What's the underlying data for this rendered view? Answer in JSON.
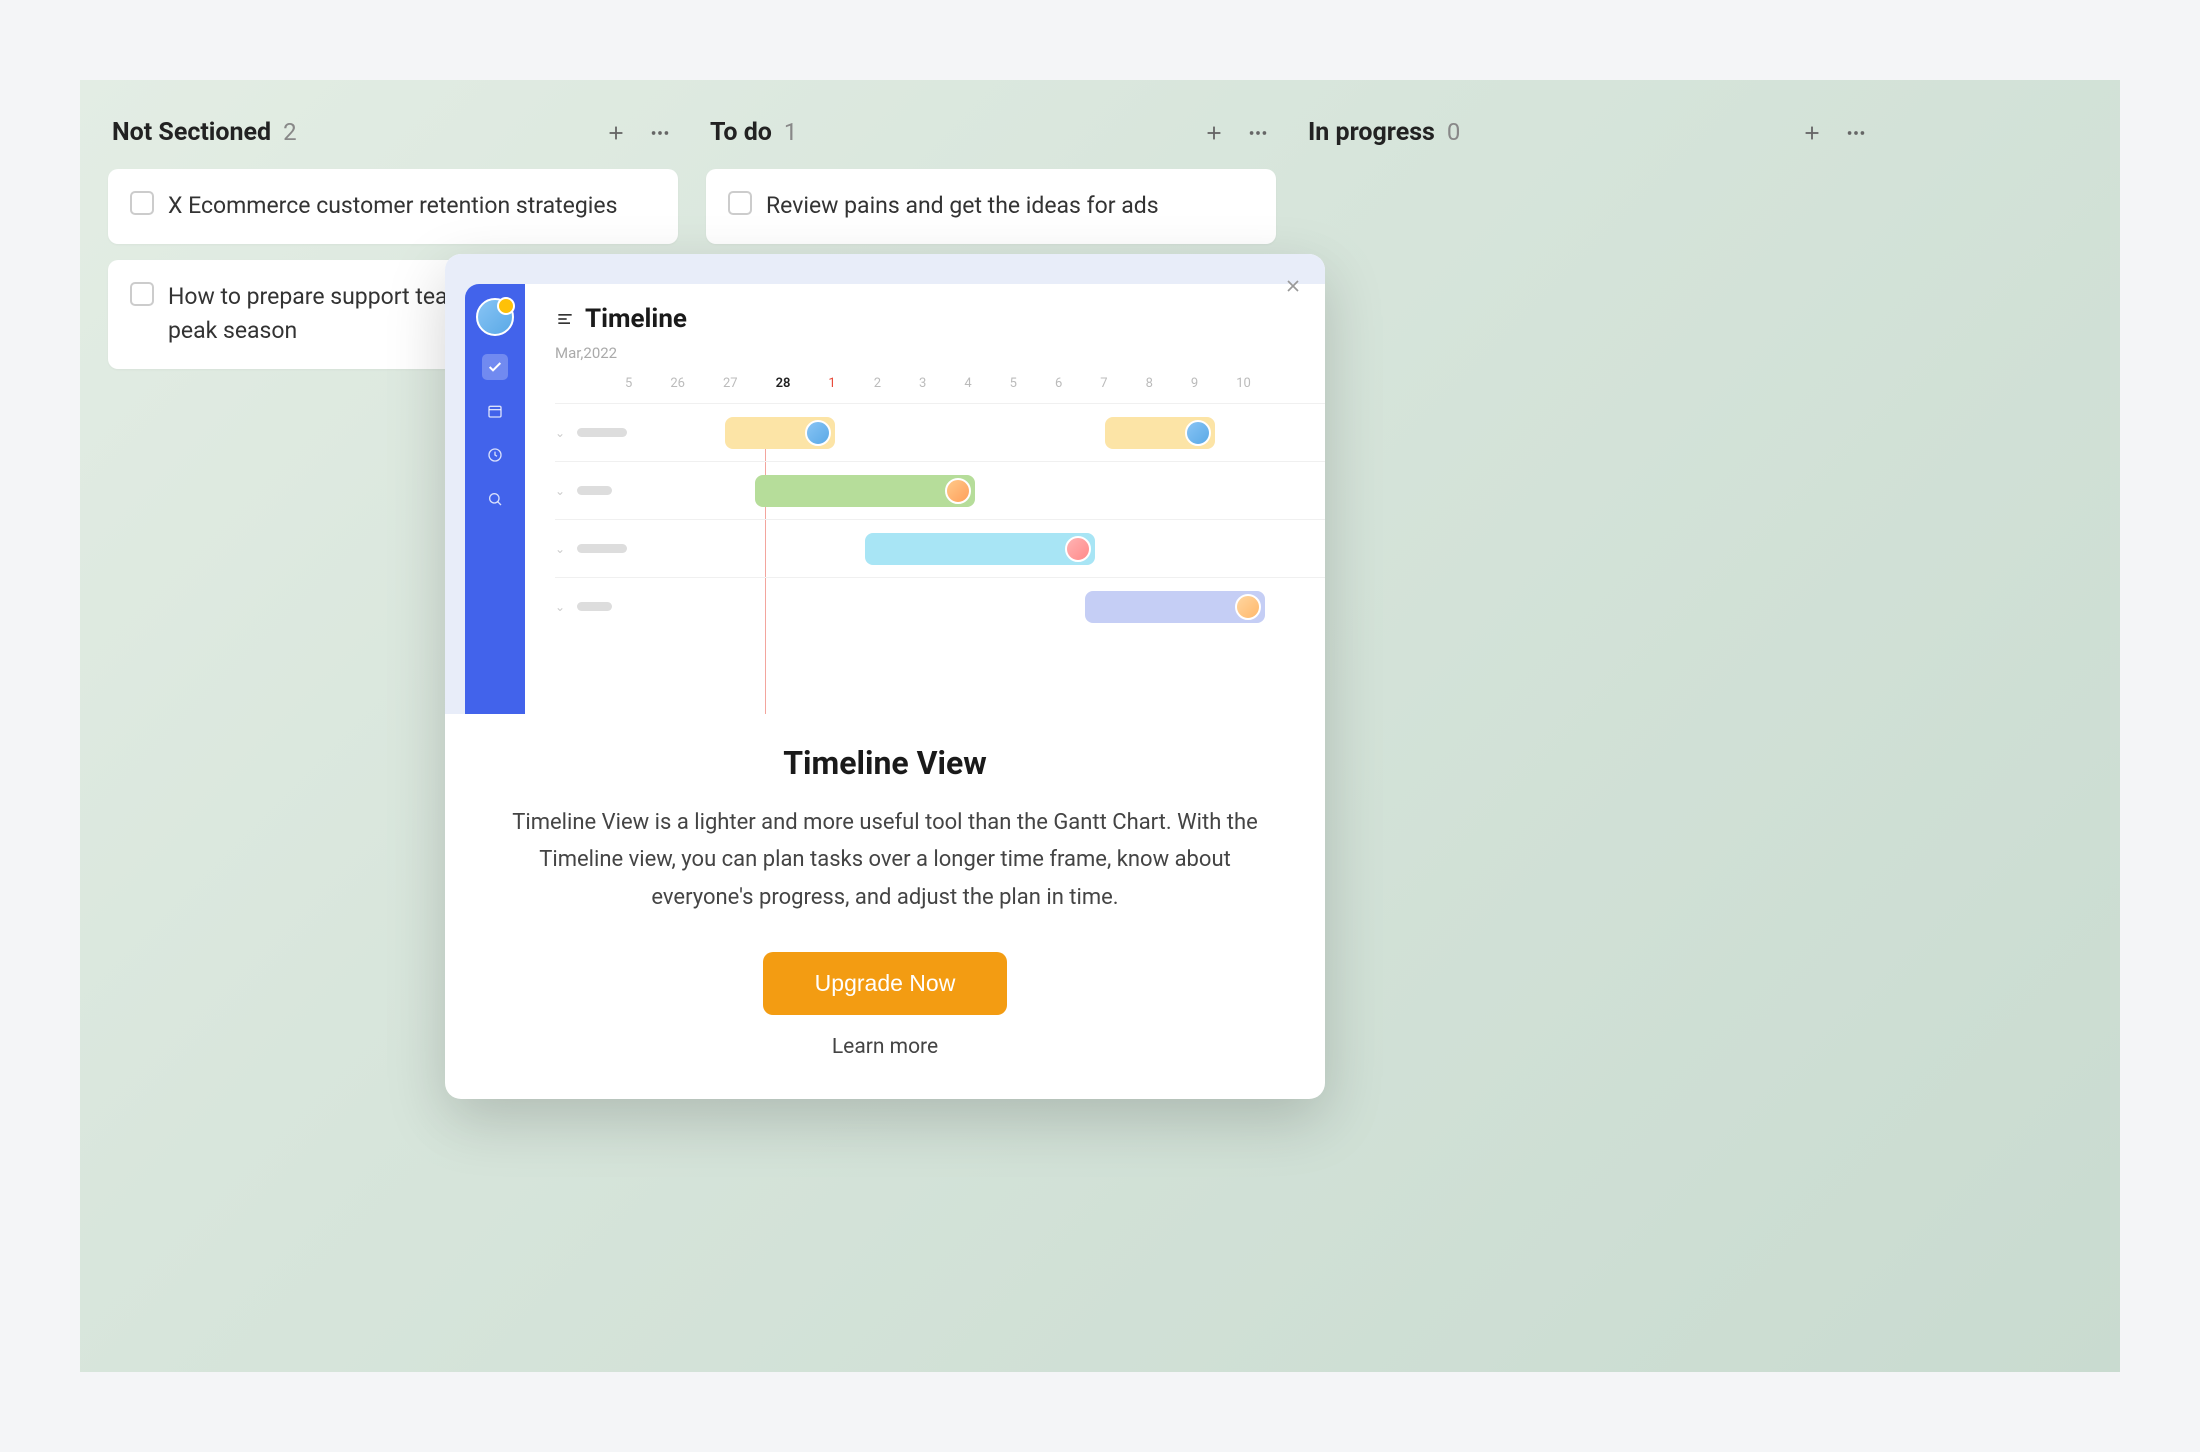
{
  "columns": [
    {
      "title": "Not Sectioned",
      "count": "2",
      "cards": [
        {
          "title": "X Ecommerce customer retention strategies"
        },
        {
          "title": "How to prepare support team for eCommerce peak season"
        }
      ]
    },
    {
      "title": "To do",
      "count": "1",
      "cards": [
        {
          "title": "Review pains and get the ideas for ads"
        }
      ]
    },
    {
      "title": "In progress",
      "count": "0",
      "cards": []
    }
  ],
  "modal": {
    "illus": {
      "title": "Timeline",
      "subtitle": "Mar,2022",
      "dates": [
        "5",
        "26",
        "27",
        "28",
        "1",
        "2",
        "3",
        "4",
        "5",
        "6",
        "7",
        "8",
        "9",
        "10"
      ]
    },
    "title": "Timeline View",
    "description": "Timeline View is a lighter and more useful tool than the Gantt Chart. With the Timeline view, you can plan tasks over a longer time frame, know about everyone's progress, and adjust the plan in time.",
    "upgrade_label": "Upgrade Now",
    "learn_more_label": "Learn more"
  }
}
